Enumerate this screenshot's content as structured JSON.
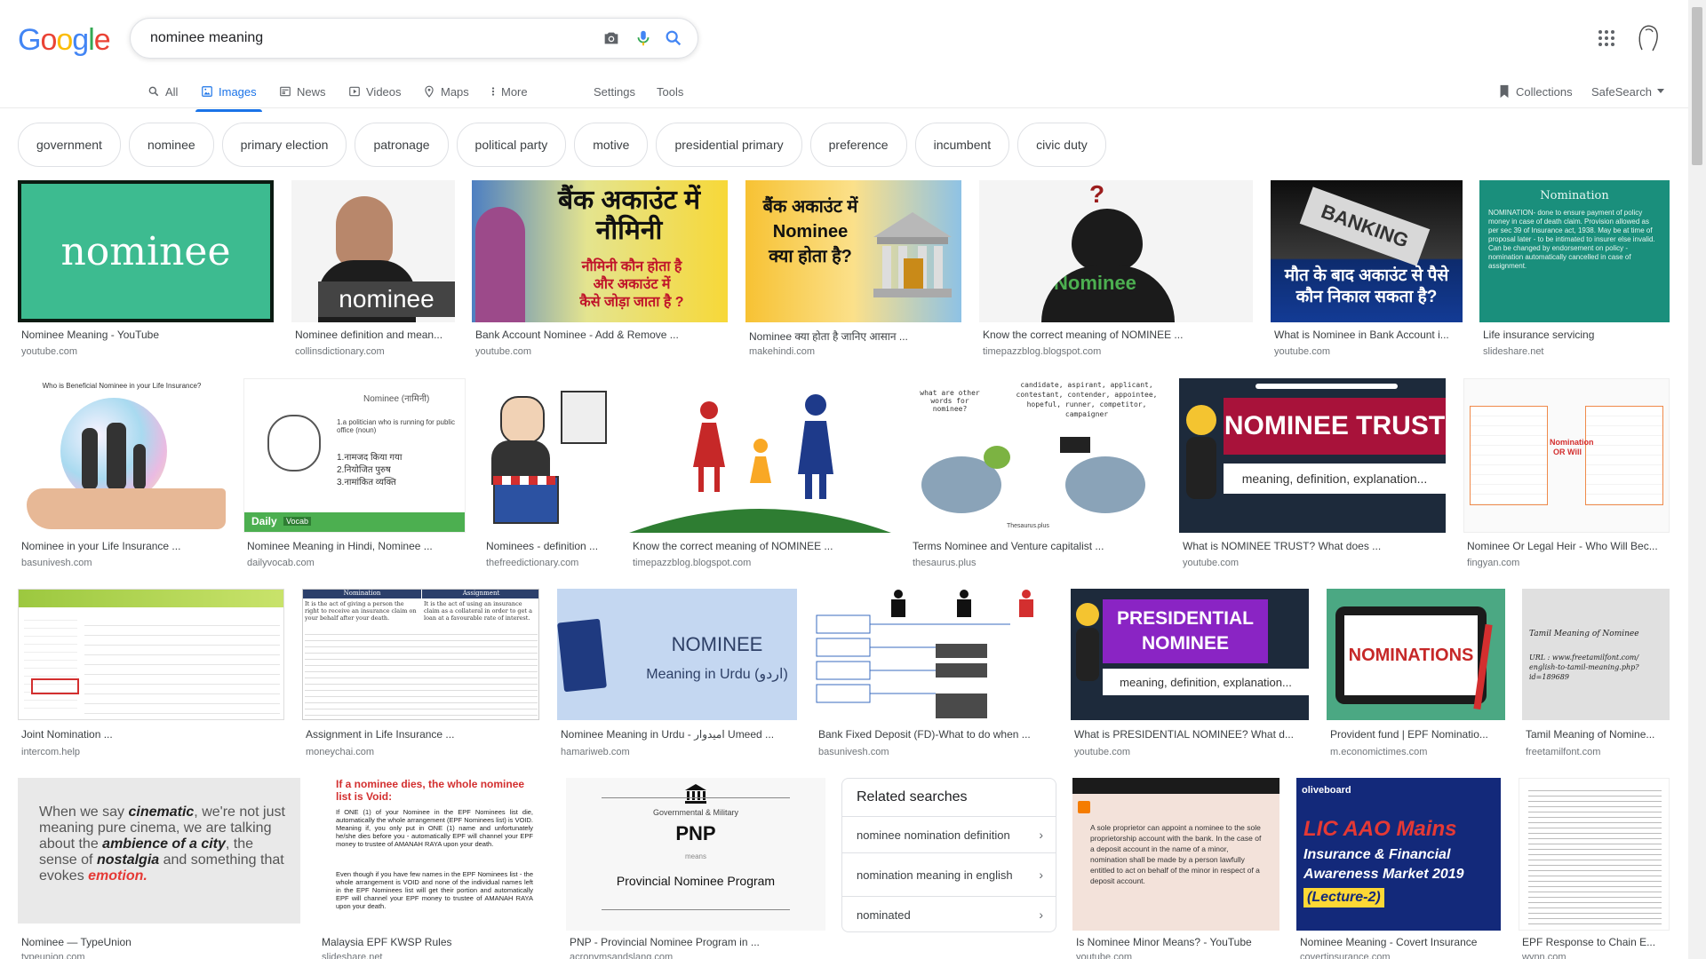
{
  "logo": {
    "letters": [
      "G",
      "o",
      "o",
      "g",
      "l",
      "e"
    ]
  },
  "search": {
    "value": "nominee meaning",
    "placeholder": ""
  },
  "tabs": [
    {
      "label": "All",
      "icon": "search-icon"
    },
    {
      "label": "Images",
      "icon": "image-icon"
    },
    {
      "label": "News",
      "icon": "news-icon"
    },
    {
      "label": "Videos",
      "icon": "video-icon"
    },
    {
      "label": "Maps",
      "icon": "map-pin-icon"
    },
    {
      "label": "More",
      "icon": "more-vertical-icon"
    }
  ],
  "tools": {
    "settings": "Settings",
    "tools": "Tools"
  },
  "right": {
    "collections": "Collections",
    "safesearch": "SafeSearch"
  },
  "chips": [
    "government",
    "nominee",
    "primary election",
    "patronage",
    "political party",
    "motive",
    "presidential primary",
    "preference",
    "incumbent",
    "civic duty"
  ],
  "results": [
    {
      "title": "Nominee Meaning - YouTube",
      "source": "youtube.com",
      "overlay": "nominee"
    },
    {
      "title": "Nominee definition and mean...",
      "source": "collinsdictionary.com",
      "overlay": "nominee"
    },
    {
      "title": "Bank Account Nominee - Add & Remove ...",
      "source": "youtube.com",
      "overlay": "बैंक अकाउंट में नौमिनी"
    },
    {
      "title": "Nominee क्या होता है जानिए आसान ...",
      "source": "makehindi.com",
      "overlay": "Nominee क्या होता है?"
    },
    {
      "title": "Know the correct meaning of NOMINEE ...",
      "source": "timepazzblog.blogspot.com",
      "overlay": "Nominee"
    },
    {
      "title": "What is Nominee in Bank Account i...",
      "source": "youtube.com",
      "overlay": "BANKING"
    },
    {
      "title": "Life insurance servicing",
      "source": "slideshare.net",
      "overlay": "Nomination"
    },
    {
      "title": "Nominee in your Life Insurance ...",
      "source": "basunivesh.com",
      "overlay": "Who is Beneficial Nominee in your Life Insurance?"
    },
    {
      "title": "Nominee Meaning in Hindi, Nominee ...",
      "source": "dailyvocab.com",
      "overlay": "Nominee (नामिनी)"
    },
    {
      "title": "Nominees - definition ...",
      "source": "thefreedictionary.com",
      "overlay": ""
    },
    {
      "title": "Know the correct meaning of NOMINEE ...",
      "source": "timepazzblog.blogspot.com",
      "overlay": ""
    },
    {
      "title": "Terms Nominee and Venture capitalist ...",
      "source": "thesaurus.plus",
      "overlay": "candidate, aspirant, applicant"
    },
    {
      "title": "What is NOMINEE TRUST? What does ...",
      "source": "youtube.com",
      "overlay": "NOMINEE TRUST"
    },
    {
      "title": "Nominee Or Legal Heir - Who Will Bec...",
      "source": "fingyan.com",
      "overlay": "Nomination OR Will"
    },
    {
      "title": "Joint Nomination ...",
      "source": "intercom.help",
      "overlay": ""
    },
    {
      "title": "Assignment in Life Insurance ...",
      "source": "moneychai.com",
      "overlay": "Nomination | Assignment"
    },
    {
      "title": "Nominee Meaning in Urdu - امیدوار Umeed ...",
      "source": "hamariweb.com",
      "overlay": "NOMINEE"
    },
    {
      "title": "Bank Fixed Deposit (FD)-What to do when ...",
      "source": "basunivesh.com",
      "overlay": ""
    },
    {
      "title": "What is PRESIDENTIAL NOMINEE? What d...",
      "source": "youtube.com",
      "overlay": "PRESIDENTIAL NOMINEE"
    },
    {
      "title": "Provident fund | EPF Nominatio...",
      "source": "m.economictimes.com",
      "overlay": "NOMINATIONS"
    },
    {
      "title": "Tamil Meaning of Nomine...",
      "source": "freetamilfont.com",
      "overlay": "Tamil Meaning of Nominee"
    },
    {
      "title": "Nominee — TypeUnion",
      "source": "typeunion.com",
      "overlay": "When we say cinematic, we're not just meaning pure cinema"
    },
    {
      "title": "Malaysia EPF KWSP Rules",
      "source": "slideshare.net",
      "overlay": "If a nominee dies, the whole nominee list is Void:"
    },
    {
      "title": "PNP - Provincial Nominee Program in ...",
      "source": "acronymsandslang.com",
      "overlay": "PNP"
    },
    {
      "title": "Is Nominee Minor Means? - YouTube",
      "source": "youtube.com",
      "overlay": ""
    },
    {
      "title": "Nominee Meaning - Covert Insurance",
      "source": "covertinsurance.com",
      "overlay": "LIC AAO Mains"
    },
    {
      "title": "EPF Response to Chain E...",
      "source": "wynn.com",
      "overlay": ""
    }
  ],
  "image_text": {
    "hindi_line2": "नौमिनी कौन होता है",
    "hindi_line3": "और अकाउंट में",
    "hindi_line4": "कैसे जोड़ा जाता है ?",
    "bank_line1": "बैंक अकाउंट में",
    "bank_line2": "Nominee",
    "bank_line3": "क्या होता है?",
    "banking_hindi": "मौत के बाद अकाउंट से पैसे कौन निकाल सकता है?",
    "lifeins_body": "NOMINATION- done to ensure payment of policy money in case of death claim. Provision allowed as per sec 39 of Insurance act, 1938. May be at time of proposal later - to be intimated to insurer else invalid. Can be changed by endorsement on policy - nomination automatically cancelled in case of assignment.",
    "daily_def": "1.a politician who is running for public office (noun)",
    "daily_hindi": "1.नामजद किया गया 2.नियोजित पुरुष 3.नामांकित व्यक्ति",
    "daily_brand": "Daily",
    "daily_brand2": "Vocab",
    "bubble_left": "what are other words for nominee?",
    "bubble_right": "candidate, aspirant, applicant, contestant, contender, appointee, hopeful, runner, competitor, campaigner",
    "thesaurus": "Thesaurus.plus",
    "trust_sub": "meaning, definition, explanation...",
    "pres_sub": "meaning, definition, explanation...",
    "urdu_sub": "Meaning in Urdu (اردو)",
    "tamil_url": "URL : www.freetamilfont.com/ english-to-tamil-meaning.php?id=189689",
    "typeunion_1": "When we say ",
    "typeunion_2": "cinematic",
    "typeunion_3": ", we're not just meaning pure cinema, we are talking about the ",
    "typeunion_4": "ambience of a city",
    "typeunion_5": ", the sense of ",
    "typeunion_6": "nostalgia",
    "typeunion_7": " and something that evokes ",
    "typeunion_8": "emotion.",
    "epf_body": "If ONE (1) of your Nominee in the EPF Nominees list die, automatically the whole arrangement (EPF Nominees list) is VOID. Meaning if, you only put in ONE (1) name and unfortunately he/she dies before you - automatically EPF will channel your EPF money to trustee of AMANAH RAYA upon your death.",
    "epf_body2": "Even though if you have few names in the EPF Nominees list - the whole arrangement is VOID and none of the individual names left in the EPF Nominees list will get their portion and automatically EPF will channel your EPF money to trustee of AMANAH RAYA upon your death.",
    "pnp_top": "Governmental & Military",
    "pnp_means": "means",
    "pnp_full": "Provincial Nominee Program",
    "minor_body": "A sole proprietor can appoint a nominee to the sole proprietorship account with the bank. In the case of a deposit account in the name of a minor, nomination shall be made by a person lawfully entitled to act on behalf of the minor in respect of a deposit account.",
    "lic_brand": "oliveboard",
    "lic_2": "Insurance & Financial",
    "lic_3": "Awareness Market 2019",
    "lic_4": "(Lecture-2)",
    "assign_left": "It is the act of giving a person the right to receive an insurance claim on your behalf after your death.",
    "assign_right": "It is the act of using an insurance claim as a collateral in order to get a loan at a favourable rate of interest."
  },
  "related": {
    "heading": "Related searches",
    "items": [
      "nominee nomination definition",
      "nomination meaning in english",
      "nominated"
    ]
  },
  "colors": {
    "accent": "#1a73e8",
    "muted": "#5f6368",
    "border": "#dfe1e5"
  }
}
